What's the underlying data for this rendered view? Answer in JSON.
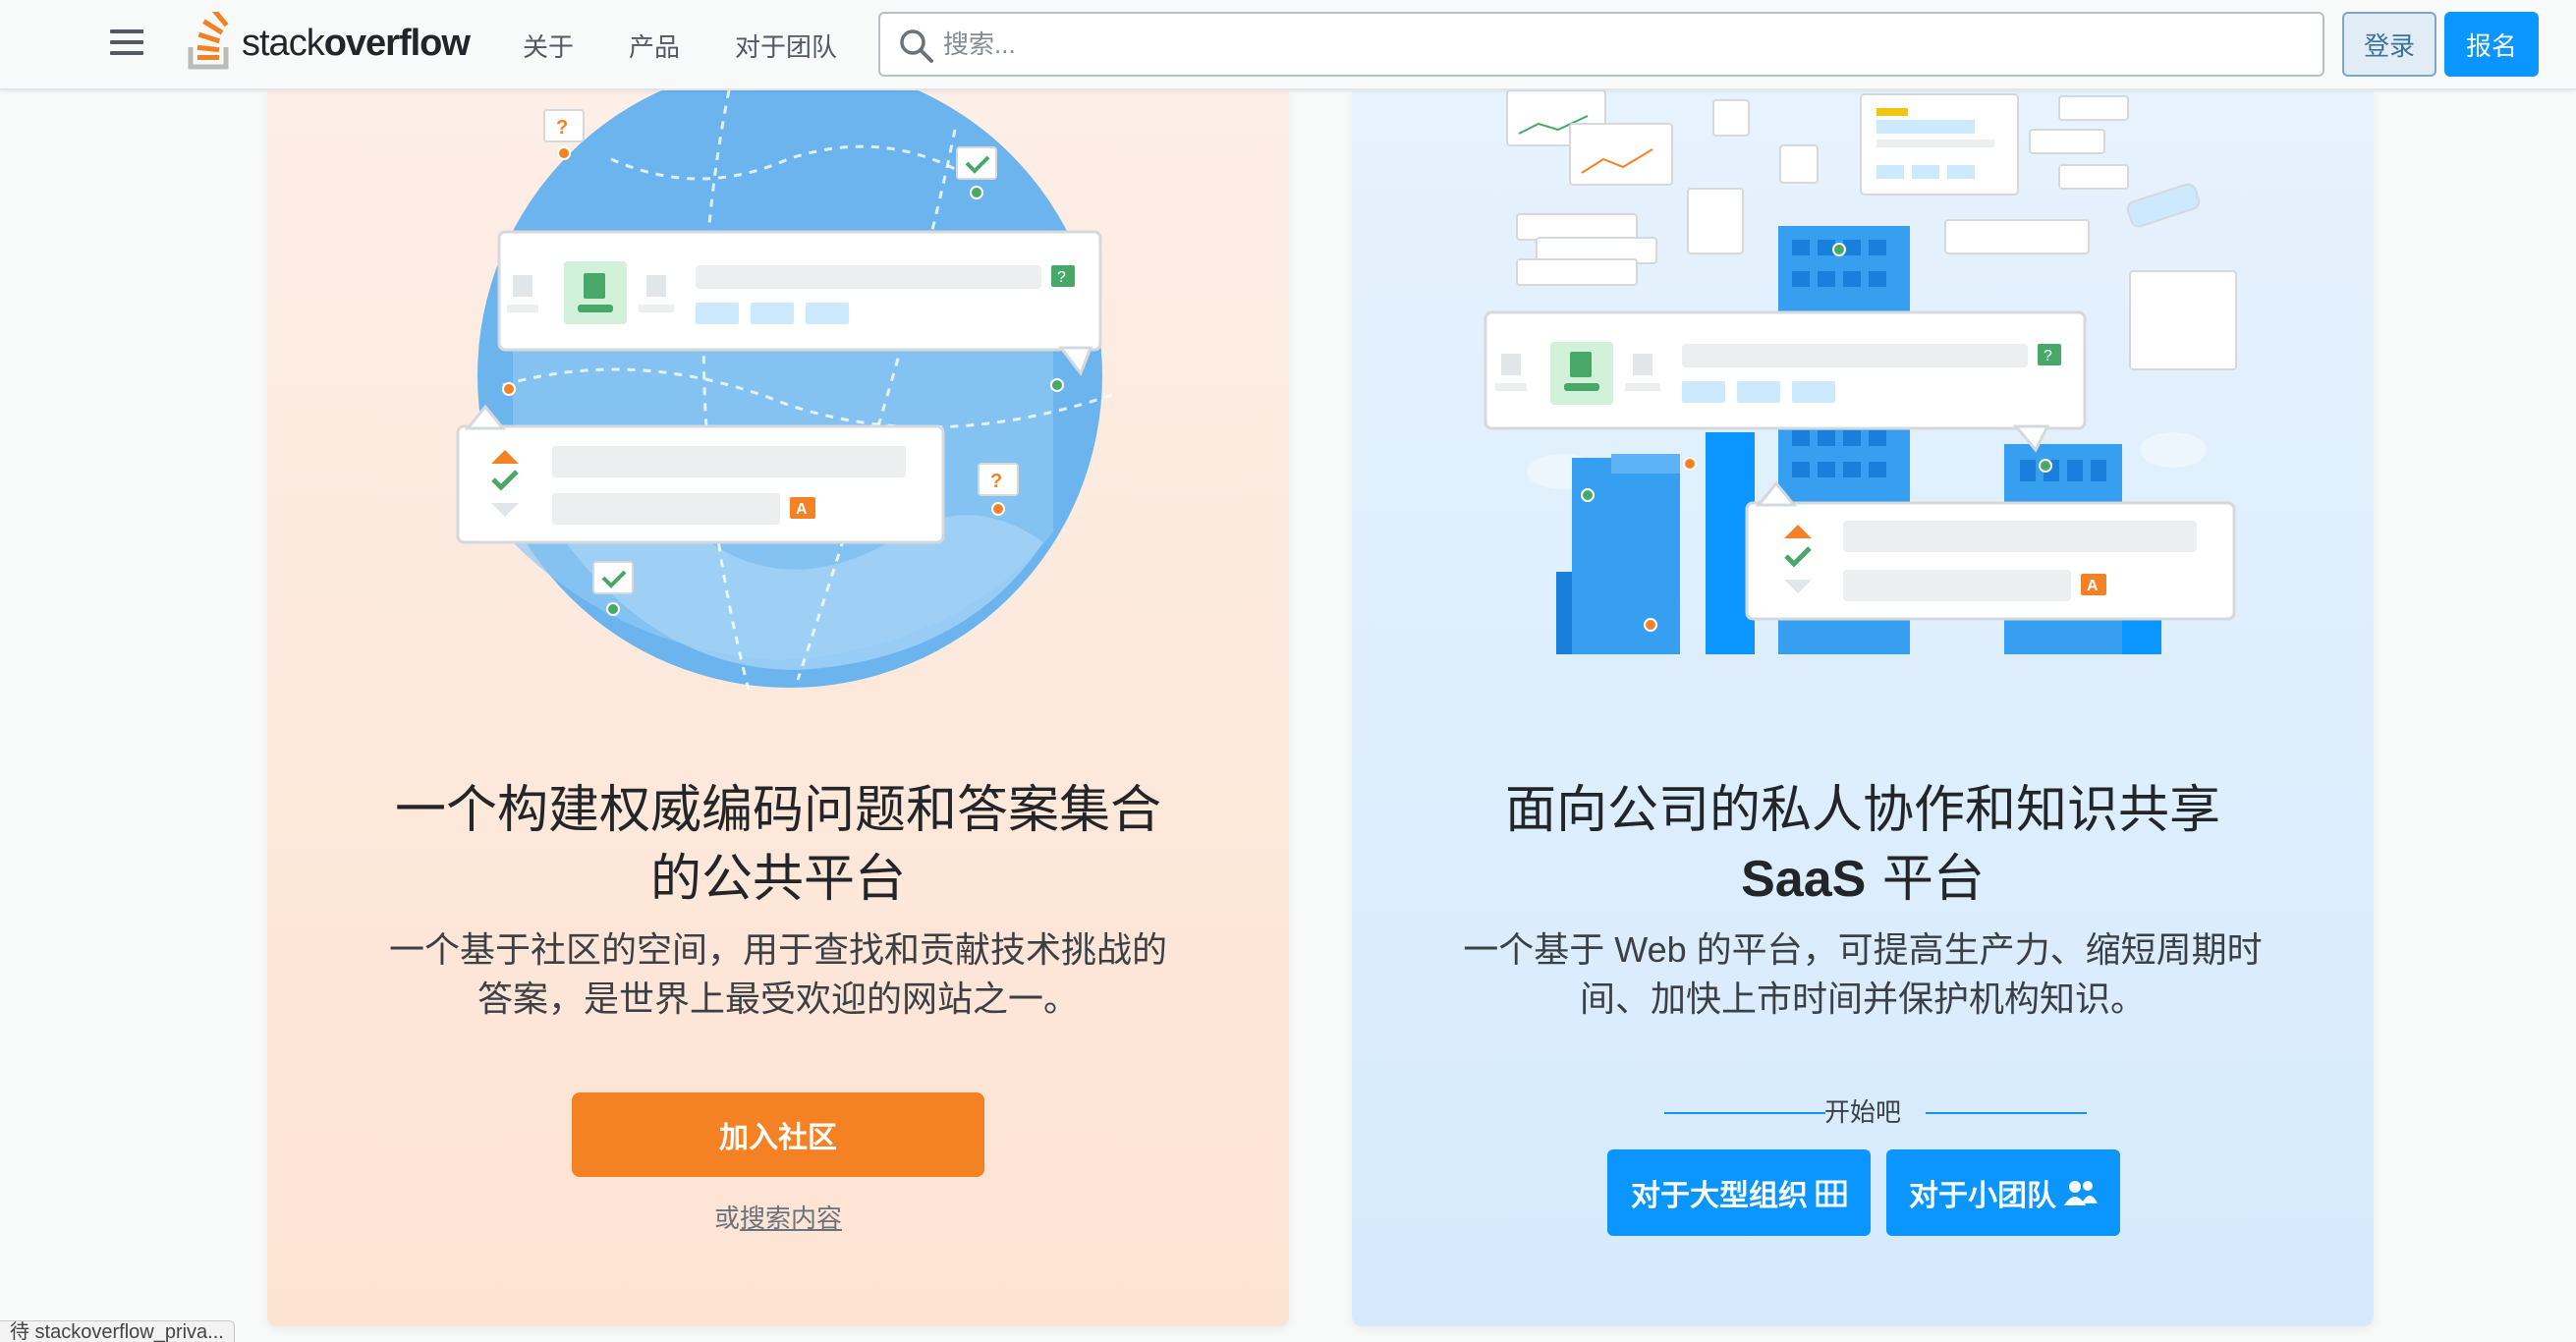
{
  "header": {
    "logo_text_light": "stack",
    "logo_text_bold": "overflow",
    "nav": [
      "关于",
      "产品",
      "对于团队"
    ],
    "search_placeholder": "搜索...",
    "login_label": "登录",
    "signup_label": "报名"
  },
  "community": {
    "title_line1": "一个构建权威编码问题和答案集合",
    "title_line2": "的公共平台",
    "desc_line1": "一个基于社区的空间，用于查找和贡献技术挑战的",
    "desc_line2": "答案，是世界上最受欢迎的网站之一。",
    "join_label": "加入社区",
    "or_label": "或",
    "search_link": "搜索内容"
  },
  "teams": {
    "title_line1": "面向公司的私人协作和知识共享",
    "title_line2_bold": "SaaS",
    "title_line2_rest": " 平台",
    "desc_line1": "一个基于 Web 的平台，可提高生产力、缩短周期时",
    "desc_line2": "间、加快上市时间并保护机构知识。",
    "start_label": "开始吧",
    "large_org_label": "对于大型组织",
    "small_team_label": "对于小团队"
  },
  "status_bar": "待 stackoverflow_priva...",
  "colors": {
    "orange": "#f48225",
    "blue": "#0a95ff",
    "left_panel_bg": "#fde8dc",
    "right_panel_bg": "#ddeefd"
  },
  "icons": {
    "menu": "hamburger-icon",
    "search": "magnifier-icon",
    "logo": "stack-logo-icon",
    "building": "building-icon",
    "people": "people-icon"
  }
}
